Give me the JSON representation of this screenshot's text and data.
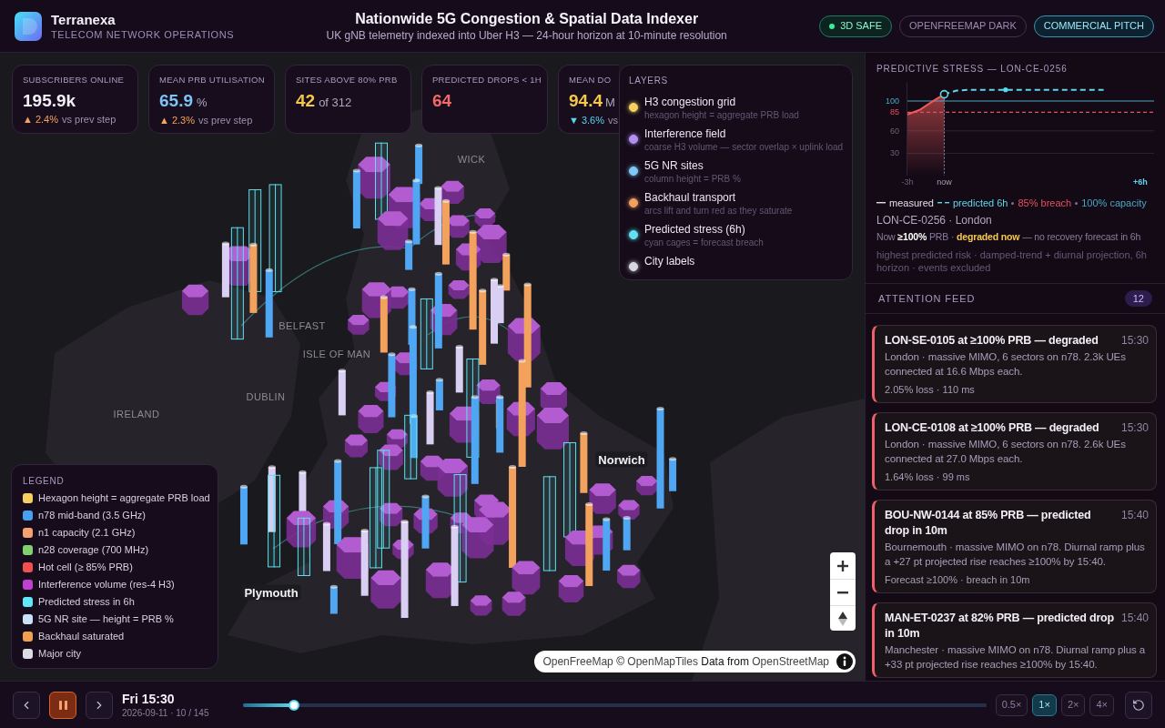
{
  "header": {
    "brand": "Terranexa",
    "tagline": "TELECOM NETWORK OPERATIONS",
    "title": "Nationwide 5G Congestion & Spatial Data Indexer",
    "subtitle": "UK gNB telemetry indexed into Uber H3 — 24-hour horizon at 10-minute resolution",
    "badges": [
      {
        "label": "3D SAFE",
        "kind": "status"
      },
      {
        "label": "OPENFREEMAP DARK",
        "kind": "muted"
      },
      {
        "label": "COMMERCIAL PITCH",
        "kind": "accent"
      }
    ]
  },
  "kpis": [
    {
      "label": "SUBSCRIBERS ONLINE",
      "value": "195.9k",
      "color": "#f4f0f8",
      "delta": {
        "text": "▲ 2.4%",
        "color": "#f5a55a",
        "suffix": "vs prev step"
      }
    },
    {
      "label": "MEAN PRB UTILISATION",
      "value": "65.9",
      "unit": "%",
      "color": "#7cc4f4",
      "delta": {
        "text": "▲ 2.3%",
        "color": "#f5a55a",
        "suffix": "vs prev step"
      }
    },
    {
      "label": "SITES ABOVE 80% PRB",
      "value": "42",
      "unit": "of 312",
      "color": "#f5c84a"
    },
    {
      "label": "PREDICTED DROPS < 1H",
      "value": "64",
      "color": "#f06a6a"
    },
    {
      "label": "MEAN DO",
      "value": "94.4",
      "unit": "M",
      "color": "#f5c84a",
      "delta": {
        "text": "▼ 3.6%",
        "color": "#5cd4ec",
        "suffix": "vs"
      }
    }
  ],
  "layers": {
    "title": "LAYERS",
    "items": [
      {
        "name": "H3 congestion grid",
        "description": "hexagon height = aggregate PRB load",
        "color": "#f5d060",
        "on": true
      },
      {
        "name": "Interference field",
        "description": "coarse H3 volume — sector overlap × uplink load",
        "color": "#b090f0",
        "on": true
      },
      {
        "name": "5G NR sites",
        "description": "column height = PRB %",
        "color": "#80c8f8",
        "on": true
      },
      {
        "name": "Backhaul transport",
        "description": "arcs lift and turn red as they saturate",
        "color": "#f0a060",
        "on": true
      },
      {
        "name": "Predicted stress (6h)",
        "description": "cyan cages = forecast breach",
        "color": "#60e0f0",
        "on": true
      },
      {
        "name": "City labels",
        "color": "#d8d8e0",
        "on": true
      }
    ]
  },
  "legend": {
    "title": "LEGEND",
    "items": [
      {
        "label": "Hexagon height = aggregate PRB load",
        "color": "#f5d060"
      },
      {
        "label": "n78 mid-band (3.5 GHz)",
        "color": "#4aa0f0"
      },
      {
        "label": "n1 capacity (2.1 GHz)",
        "color": "#f5a070"
      },
      {
        "label": "n28 coverage (700 MHz)",
        "color": "#80d070"
      },
      {
        "label": "Hot cell (≥ 85% PRB)",
        "color": "#f05050"
      },
      {
        "label": "Interference volume (res-4 H3)",
        "color": "#c040d0"
      },
      {
        "label": "Predicted stress in 6h",
        "color": "#60e8f8"
      },
      {
        "label": "5G NR site — height = PRB %",
        "color": "#c8e0f8"
      },
      {
        "label": "Backhaul saturated",
        "color": "#f0a050"
      },
      {
        "label": "Major city",
        "color": "#dcdce4"
      }
    ]
  },
  "map": {
    "labels": [
      {
        "text": "WICK",
        "kind": "place"
      },
      {
        "text": "BELFAST",
        "kind": "place"
      },
      {
        "text": "ISLE OF MAN",
        "kind": "place"
      },
      {
        "text": "DUBLIN",
        "kind": "place"
      },
      {
        "text": "IRELAND",
        "kind": "place"
      },
      {
        "text": "Norwich",
        "kind": "city"
      },
      {
        "text": "Plymouth",
        "kind": "city"
      }
    ],
    "attribution": [
      {
        "kind": "link",
        "text": "OpenFreeMap"
      },
      {
        "kind": "text",
        "text": "©"
      },
      {
        "kind": "link",
        "text": "OpenMapTiles"
      },
      {
        "kind": "text",
        "text": "Data from"
      },
      {
        "kind": "link",
        "text": "OpenStreetMap"
      }
    ]
  },
  "stress_panel": {
    "title": "PREDICTIVE STRESS — LON-CE-0256",
    "chart_data": {
      "type": "line",
      "categories": [
        "-3h",
        null,
        null,
        "now",
        null,
        null,
        null,
        null,
        null,
        null,
        null,
        null,
        null,
        null,
        null,
        null,
        null,
        null,
        null,
        "+6h"
      ],
      "series": [
        {
          "name": "measured",
          "color": "#f05a5a",
          "line_style": "solid",
          "values": [
            82,
            88,
            99,
            109,
            null,
            null,
            null,
            null,
            null,
            null,
            null,
            null,
            null,
            null,
            null,
            null,
            null,
            null,
            null,
            null
          ]
        },
        {
          "name": "predicted 6h",
          "color": "#5cd8ea",
          "line_style": "dashed",
          "values": [
            null,
            null,
            null,
            109,
            114,
            115,
            115,
            115,
            115,
            115,
            115,
            115,
            115,
            115,
            115,
            115,
            115,
            null,
            null,
            null
          ]
        }
      ],
      "ylim": [
        0,
        125
      ],
      "yticks": [
        30,
        60,
        85,
        100
      ],
      "ref_lines": [
        {
          "axis": "y",
          "value": 85,
          "label": "85% breach",
          "color": "#e8505e",
          "line_style": "dashed"
        },
        {
          "axis": "y",
          "value": 100,
          "label": "100% capacity",
          "color": "#4aa8c0",
          "line_style": "solid"
        }
      ]
    },
    "site": "LON-CE-0256 · London",
    "status": "Now **≥100%** PRB · **degraded now** — no recovery forecast in 6h",
    "note": "highest predicted risk · damped-trend + diurnal projection, 6h horizon · events excluded"
  },
  "attention_feed": {
    "title": "ATTENTION FEED",
    "count": "12",
    "items": [
      {
        "title": "LON-SE-0105 at ≥100% PRB — degraded",
        "time": "15:30",
        "body": "London · massive MIMO, 6 sectors on n78. 2.3k UEs connected at 16.6 Mbps each.",
        "meta": "2.05% loss · 110 ms"
      },
      {
        "title": "LON-CE-0108 at ≥100% PRB — degraded",
        "time": "15:30",
        "body": "London · massive MIMO, 6 sectors on n78. 2.6k UEs connected at 27.0 Mbps each.",
        "meta": "1.64% loss · 99 ms"
      },
      {
        "title": "BOU-NW-0144 at 85% PRB — predicted drop in 10m",
        "time": "15:40",
        "body": "Bournemouth · massive MIMO on n78. Diurnal ramp plus a +27 pt projected rise reaches ≥100% by 15:40.",
        "meta": "Forecast ≥100% · breach in 10m"
      },
      {
        "title": "MAN-ET-0237 at 82% PRB — predicted drop in 10m",
        "time": "15:40",
        "body": "Manchester · massive MIMO on n78. Diurnal ramp plus a +33 pt projected rise reaches ≥100% by 15:40."
      }
    ]
  },
  "playback": {
    "playing": true,
    "time": "Fri 15:30",
    "date": "2026-09-11 · 10 / 145",
    "level": 0.069,
    "speeds": [
      {
        "label": "0.5×",
        "selected": false
      },
      {
        "label": "1×",
        "selected": true
      },
      {
        "label": "2×",
        "selected": false
      },
      {
        "label": "4×",
        "selected": false
      }
    ]
  }
}
